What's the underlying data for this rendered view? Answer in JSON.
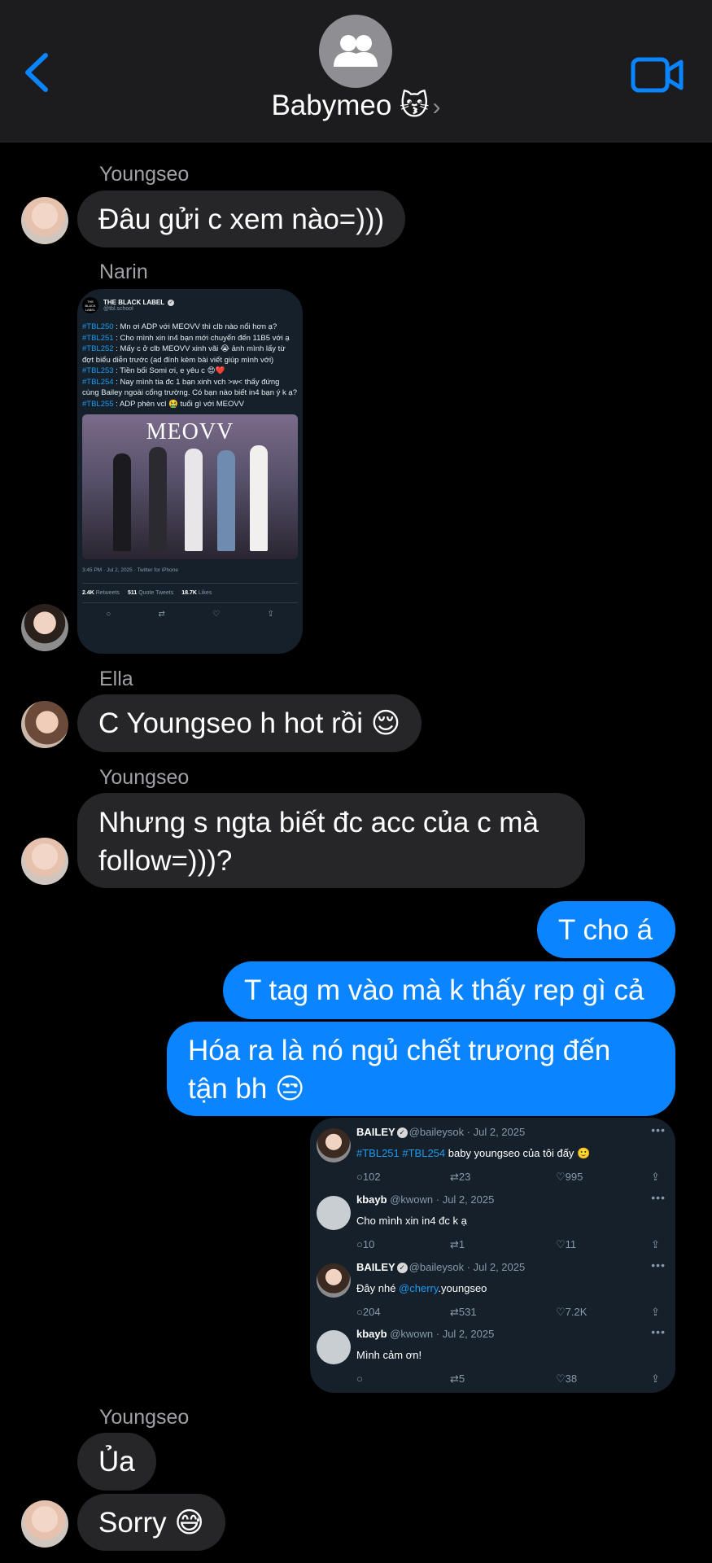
{
  "header": {
    "title": "Babymeo 😽",
    "chevron": "›",
    "back_icon": "chevron-left-icon",
    "video_icon": "video-camera-icon",
    "avatar_icon": "group-people-icon",
    "accent": "#0a84ff"
  },
  "messages": [
    {
      "sender": "Youngseo",
      "text": "Đâu gửi c xem nào=)))"
    },
    {
      "sender": "Narin",
      "type": "image"
    },
    {
      "sender": "Ella",
      "text": "C Youngseo h hot rồi 😌"
    },
    {
      "sender": "Youngseo",
      "text": "Nhưng s ngta biết đc acc của c mà follow=)))?"
    },
    {
      "sender": "me",
      "text": "T cho á"
    },
    {
      "sender": "me",
      "text": "T tag m vào mà k thấy rep gì cả"
    },
    {
      "sender": "me",
      "text": "Hóa ra là nó ngủ chết trương đến tận bh 😒"
    },
    {
      "sender": "me",
      "type": "image"
    },
    {
      "sender": "Youngseo",
      "text": "Ủa"
    },
    {
      "sender": "Youngseo",
      "text": "Sorry 😅"
    }
  ],
  "shared_tweet": {
    "logo": "THE BLACK LABEL",
    "name": "THE BLACK LABEL",
    "handle": "@tbl.school",
    "lines": [
      {
        "tag": "#TBL250",
        "text": " : Mn ơi ADP với MEOVV thì clb nào nổi hơn ạ?"
      },
      {
        "tag": "#TBL251",
        "text": " : Cho mình xin in4 bạn mới chuyển đến 11B5 với ạ"
      },
      {
        "tag": "#TBL252",
        "text": " : Mấy c ở clb MEOVV xinh vãi 😭 ảnh mình lấy từ đợt biểu diễn trước (ad đính kèm bài viết giúp mình với)"
      },
      {
        "tag": "#TBL253",
        "text": " : Tiền bối Somi ơi, e yêu c 😍❤️"
      },
      {
        "tag": "#TBL254",
        "text": " : Nay mình tia đc 1 bạn xinh vch >w< thấy đứng cùng Bailey ngoài cổng trường. Có bạn nào biết in4 bạn ý k ạ?"
      },
      {
        "tag": "#TBL255",
        "text": " : ADP phèn vcl 🤮 tuổi gì với MEOVV"
      }
    ],
    "photo_title": "MEOVV",
    "meta": "3:45 PM · Jul 2, 2025 · Twitter for iPhone",
    "retweets": "2.4K",
    "retweets_label": "Retweets",
    "quotes": "511",
    "quotes_label": "Quote Tweets",
    "likes": "18.7K",
    "likes_label": "Likes",
    "action_icons": [
      "reply-icon",
      "retweet-icon",
      "like-icon",
      "share-icon"
    ]
  },
  "thread": [
    {
      "name": "BAILEY",
      "handle": "@baileysok · Jul 2, 2025",
      "verified": true,
      "tags": "#TBL251 #TBL254",
      "text": " baby youngseo của tôi đấy 🙂",
      "replies": "102",
      "retweets": "23",
      "likes": "995"
    },
    {
      "name": "kbayb",
      "handle": "@kwown · Jul 2, 2025",
      "verified": false,
      "tags": "",
      "text": "Cho mình xin in4 đc k ạ",
      "replies": "10",
      "retweets": "1",
      "likes": "11"
    },
    {
      "name": "BAILEY",
      "handle": "@baileysok · Jul 2, 2025",
      "verified": true,
      "tags": "",
      "text": "Đây nhé ",
      "mention": "@cherry",
      "mention_tail": ".youngseo",
      "replies": "204",
      "retweets": "531",
      "likes": "7.2K"
    },
    {
      "name": "kbayb",
      "handle": "@kwown · Jul 2, 2025",
      "verified": false,
      "tags": "",
      "text": "Mình cảm ơn!",
      "replies": "",
      "retweets": "5",
      "likes": "38"
    }
  ]
}
